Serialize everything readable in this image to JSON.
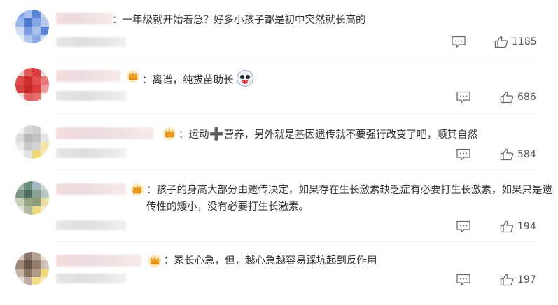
{
  "icons": {
    "badge": "crown-badge-icon",
    "reply": "reply-icon",
    "like": "thumbs-up-icon"
  },
  "comments": [
    {
      "text": "：一年级就开始着急？好多小孩子都是初中突然就长高的",
      "likes": "1185"
    },
    {
      "text_prefix": "：离谱，纯拔苗助长",
      "emoji": "laughing-crying-emoji-icon",
      "likes": "686"
    },
    {
      "text_prefix": "：运动",
      "plus": "➕",
      "text_suffix": "营养，另外就是基因遗传就不要强行改变了吧，顺其自然",
      "likes": "584"
    },
    {
      "text": "：孩子的身高大部分由遗传决定，如果存在生长激素缺乏症有必要打生长激素，如果只是遗传性的矮小，没有必要打生长激素。",
      "likes": "194"
    },
    {
      "text": "：家长心急，但，越心急越容易踩坑起到反作用",
      "likes": "197"
    }
  ],
  "colors": {
    "text": "#333333",
    "meta": "#555555",
    "divider": "#eeeeee"
  }
}
